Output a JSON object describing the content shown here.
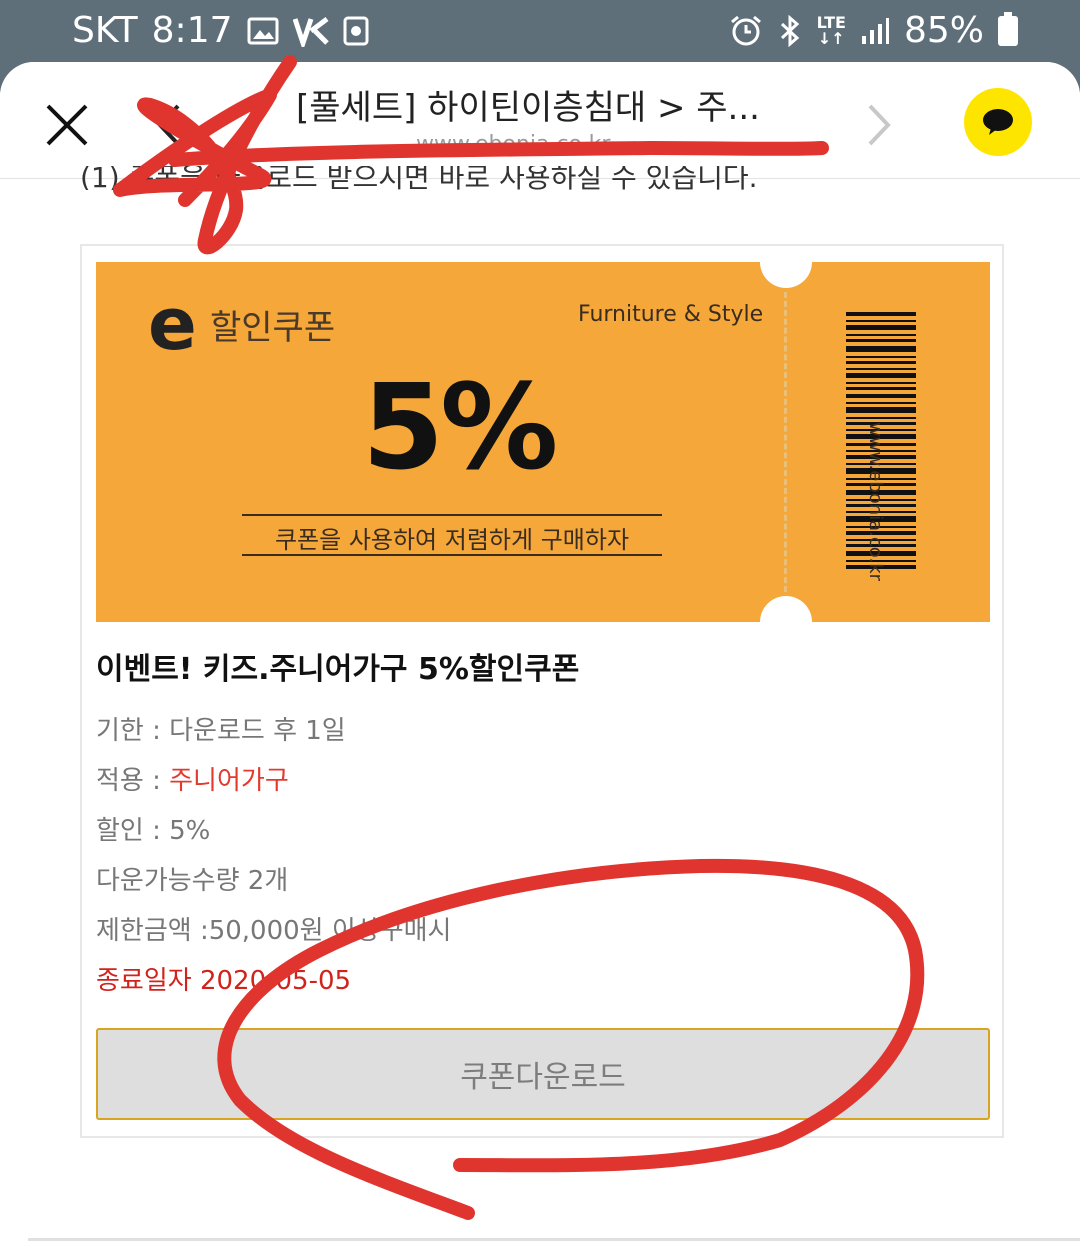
{
  "status_bar": {
    "carrier": "SKT",
    "time": "8:17",
    "network": "LTE",
    "battery": "85%"
  },
  "browser": {
    "title": "[풀세트] 하이틴이층침대 > 주...",
    "url": "www.ebonia.co.kr"
  },
  "cut_text": "(1) 쿠폰을 다운로드 받으시면 바로 사용하실 수 있습니다.",
  "coupon": {
    "logo_letter": "e",
    "kind": "할인쿠폰",
    "brand_tag": "Furniture & Style",
    "percent": "5%",
    "slogan": "쿠폰을 사용하여 저렴하게 구매하자",
    "site": "www.ebonia.co.kr",
    "name": "이벤트! 키즈.주니어가구 5%할인쿠폰",
    "period_label": "기한 : ",
    "period_value": "다운로드 후 1일",
    "apply_label": "적용 : ",
    "apply_value": "주니어가구",
    "discount": "할인 : 5%",
    "quantity": "다운가능수량 2개",
    "limit": "제한금액 :50,000원 이상구매시",
    "end_date": "종료일자 2020-05-05",
    "download_label": "쿠폰다운로드"
  },
  "colors": {
    "ticket": "#f5a73a",
    "kakao": "#fee500",
    "highlight": "#e33a2f",
    "annotation": "#e0352f"
  }
}
